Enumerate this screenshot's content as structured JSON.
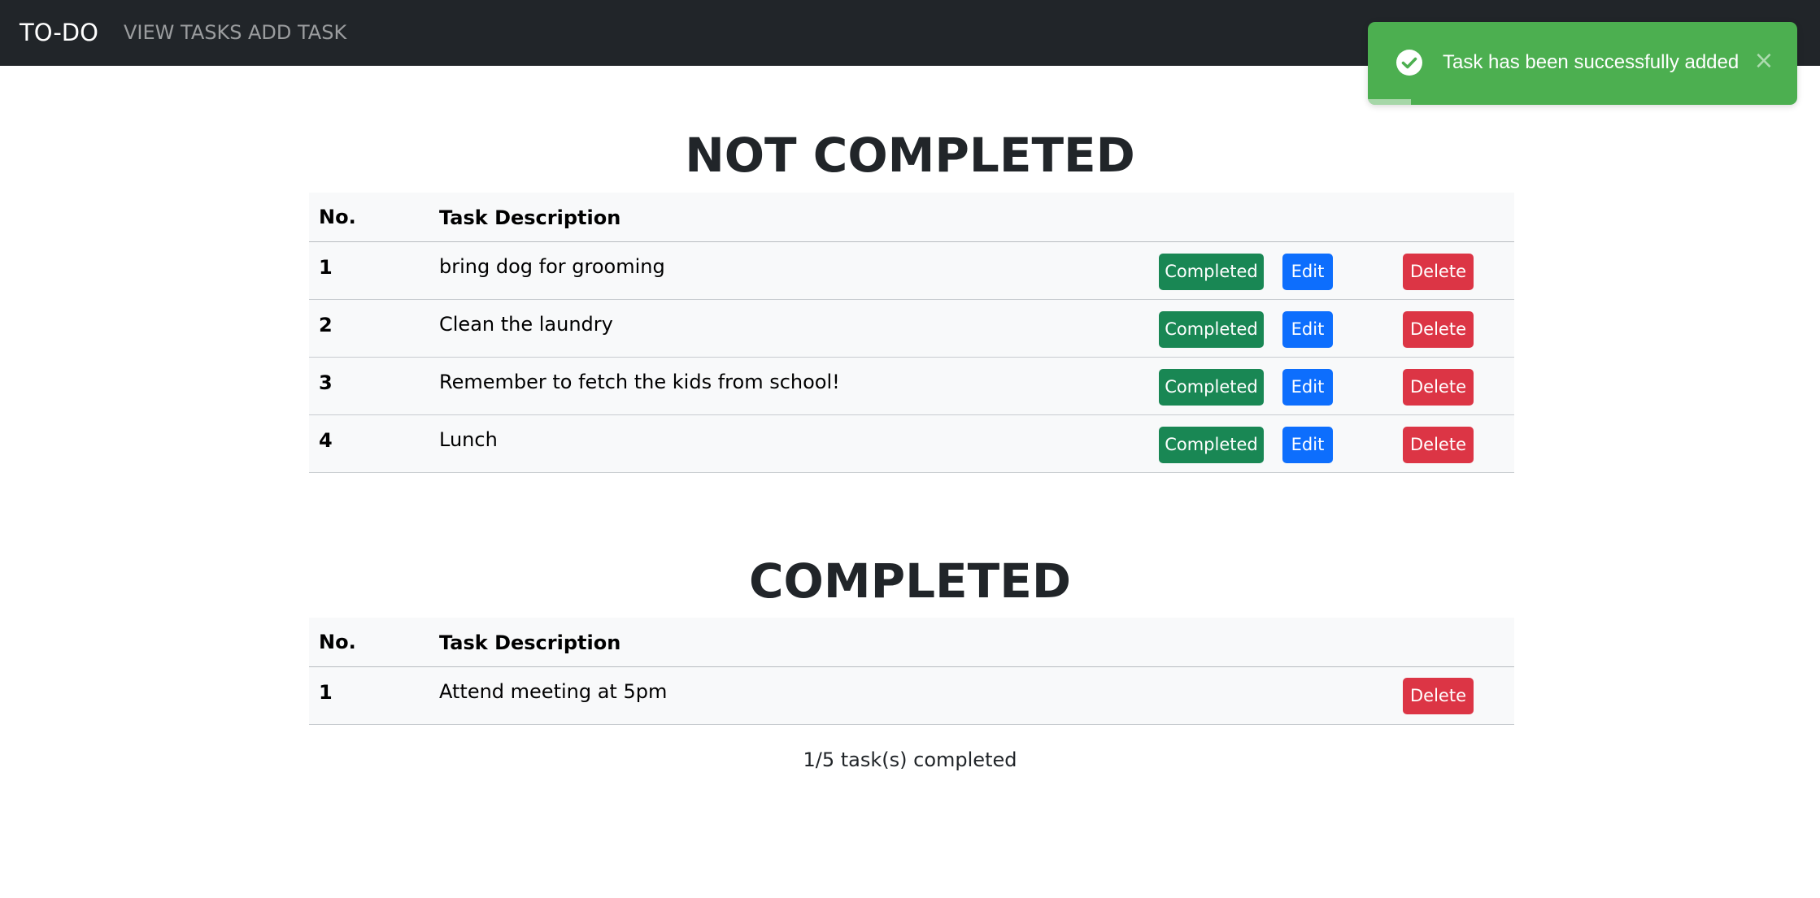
{
  "navbar": {
    "brand": "TO-DO",
    "links": [
      "VIEW TASKS",
      "ADD TASK"
    ]
  },
  "toast": {
    "message": "Task has been successfully added",
    "close_label": "×",
    "icon": "check-circle-icon",
    "color": "#4caf50",
    "progress": 0.1
  },
  "not_completed": {
    "title": "NOT COMPLETED",
    "headers": {
      "no": "No.",
      "description": "Task Description"
    },
    "rows": [
      {
        "no": "1",
        "description": "bring dog for grooming"
      },
      {
        "no": "2",
        "description": "Clean the laundry"
      },
      {
        "no": "3",
        "description": "Remember to fetch the kids from school!"
      },
      {
        "no": "4",
        "description": "Lunch"
      }
    ],
    "buttons": {
      "completed": "Completed",
      "edit": "Edit",
      "delete": "Delete"
    }
  },
  "completed": {
    "title": "COMPLETED",
    "headers": {
      "no": "No.",
      "description": "Task Description"
    },
    "rows": [
      {
        "no": "1",
        "description": "Attend meeting at 5pm"
      }
    ],
    "buttons": {
      "delete": "Delete"
    }
  },
  "summary": "1/5 task(s) completed",
  "colors": {
    "navbar": "#212529",
    "completed_button": "#198754",
    "edit_button": "#0d6efd",
    "delete_button": "#dc3545"
  }
}
